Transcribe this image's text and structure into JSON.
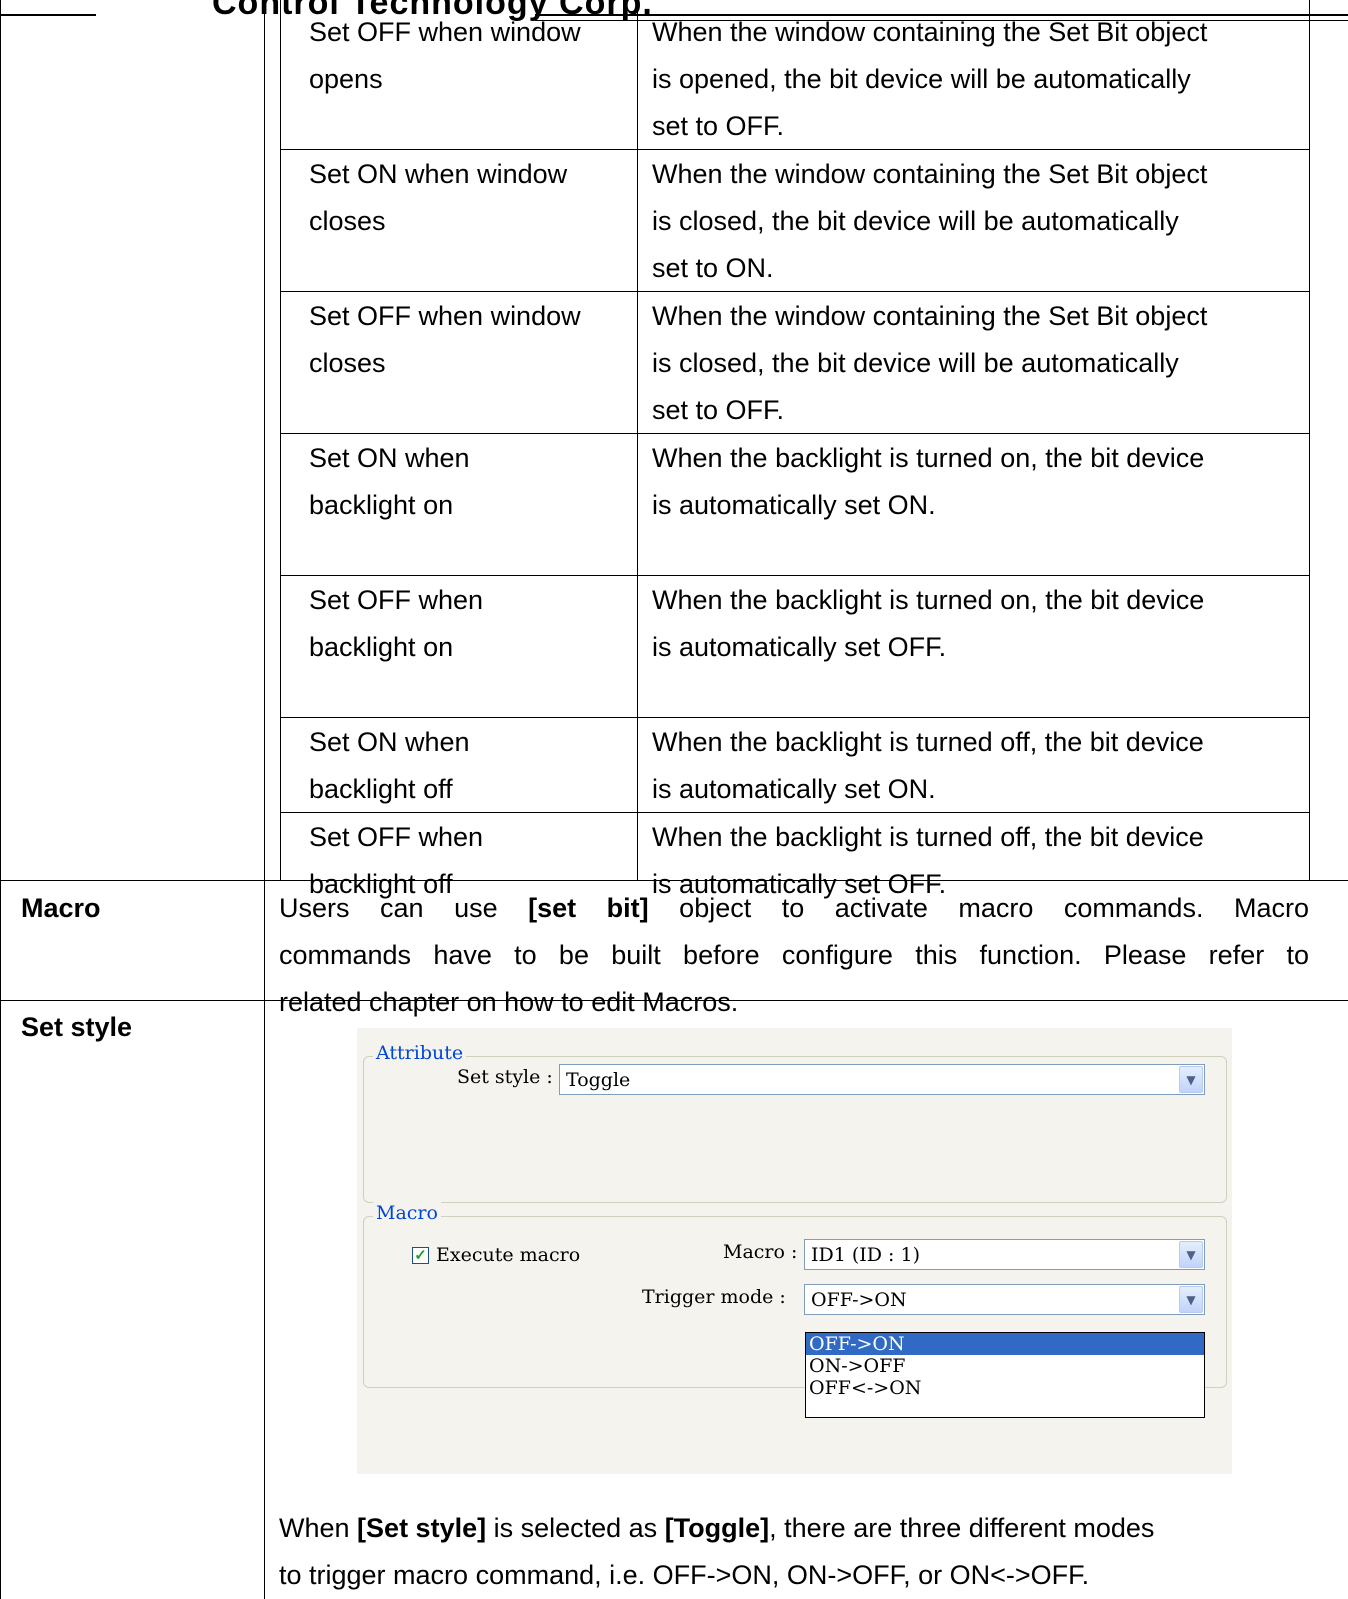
{
  "header": {
    "text": "Control Technology Corp."
  },
  "sub_rows": [
    {
      "option": [
        "Set OFF when window",
        "opens"
      ],
      "description": [
        "When the window containing the Set Bit object",
        "is opened, the bit device will be automatically",
        "set to OFF."
      ]
    },
    {
      "option": [
        "Set ON when window",
        "closes"
      ],
      "description": [
        "When the window containing the Set Bit object",
        "is closed, the bit device will be automatically",
        "set to ON."
      ]
    },
    {
      "option": [
        "Set OFF when window",
        "closes"
      ],
      "description": [
        "When the window containing the Set Bit object",
        "is closed, the bit device will be automatically",
        "set to OFF."
      ]
    },
    {
      "option": [
        "Set ON when",
        "backlight on"
      ],
      "description": [
        "When the backlight is turned on, the bit device",
        "is automatically set ON."
      ]
    },
    {
      "option": [
        "Set OFF when",
        "backlight on"
      ],
      "description": [
        "When the backlight is turned on, the bit device",
        "is automatically set OFF."
      ]
    },
    {
      "option": [
        "Set ON when",
        "backlight off"
      ],
      "description": [
        "When the backlight is turned off, the bit device",
        "is automatically set ON."
      ]
    },
    {
      "option": [
        "Set OFF when",
        "backlight off"
      ],
      "description": [
        "When the backlight is turned off, the bit device",
        "is automatically set OFF."
      ]
    }
  ],
  "macro_row": {
    "label": "Macro",
    "line1": {
      "a": "Users can use ",
      "bold": "[set bit]",
      "b": " object to activate macro commands. Macro"
    },
    "line2": "commands have to be built before configure this function. Please refer to",
    "line3": "related chapter on how to edit Macros."
  },
  "setstyle_row": {
    "label": "Set style",
    "note_line1": {
      "a": "When ",
      "bold1": "[Set style]",
      "b": " is selected as ",
      "bold2": "[Toggle]",
      "c": ", there are three different modes"
    },
    "note_line2": "to trigger macro command, i.e. OFF->ON, ON->OFF, or ON<->OFF."
  },
  "dialog": {
    "attribute_group": "Attribute",
    "set_style_label": "Set style :",
    "set_style_value": "Toggle",
    "macro_group": "Macro",
    "execute_macro_label": "Execute macro",
    "execute_macro_checked": true,
    "macro_label": "Macro :",
    "macro_value": "ID1 (ID : 1)",
    "trigger_mode_label": "Trigger mode :",
    "trigger_mode_value": "OFF->ON",
    "trigger_options": [
      "OFF->ON",
      "ON->OFF",
      "OFF<->ON"
    ],
    "selected_option": "OFF->ON"
  }
}
